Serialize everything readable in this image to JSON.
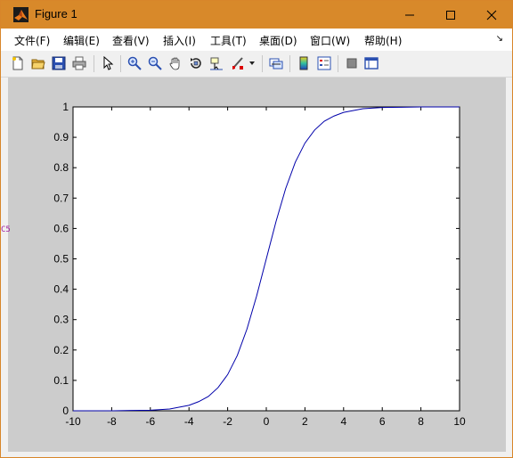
{
  "window": {
    "title": "Figure 1",
    "controls": {
      "minimize": "minimize",
      "maximize": "maximize",
      "close": "close"
    }
  },
  "menu": {
    "items": [
      "文件(F)",
      "编辑(E)",
      "查看(V)",
      "插入(I)",
      "工具(T)",
      "桌面(D)",
      "窗口(W)",
      "帮助(H)"
    ],
    "overflow_arrow": "↘"
  },
  "toolbar": {
    "buttons": [
      "new-figure-icon",
      "open-file-icon",
      "save-icon",
      "print-icon",
      "pointer-icon",
      "zoom-in-icon",
      "zoom-out-icon",
      "pan-hand-icon",
      "rotate-3d-icon",
      "data-cursor-icon",
      "brush-icon",
      "brush-dropdown-icon",
      "link-plot-icon",
      "colorbar-icon",
      "legend-icon",
      "hide-plot-tools-icon",
      "show-plot-tools-icon"
    ]
  },
  "side_mark": "C5",
  "colors": {
    "titlebar": "#d8892a",
    "figure_bg": "#cccccc",
    "line": "#0000aa"
  },
  "chart_data": {
    "type": "line",
    "title": "",
    "xlabel": "",
    "ylabel": "",
    "xlim": [
      -10,
      10
    ],
    "ylim": [
      0,
      1
    ],
    "xticks": [
      -10,
      -8,
      -6,
      -4,
      -2,
      0,
      2,
      4,
      6,
      8,
      10
    ],
    "yticks": [
      0,
      0.1,
      0.2,
      0.3,
      0.4,
      0.5,
      0.6,
      0.7,
      0.8,
      0.9,
      1
    ],
    "ytick_labels": [
      "0",
      "0.1",
      "0.2",
      "0.3",
      "0.4",
      "0.5",
      "0.6",
      "0.7",
      "0.8",
      "0.9",
      "1"
    ],
    "grid": false,
    "series": [
      {
        "color": "#0000aa",
        "x": [
          -10,
          -9,
          -8,
          -7,
          -6,
          -5,
          -4,
          -3.5,
          -3,
          -2.5,
          -2,
          -1.5,
          -1,
          -0.5,
          0,
          0.5,
          1,
          1.5,
          2,
          2.5,
          3,
          3.5,
          4,
          5,
          6,
          7,
          8,
          9,
          10
        ],
        "y": [
          0.0,
          0.0,
          0.0,
          0.001,
          0.002,
          0.006,
          0.018,
          0.03,
          0.047,
          0.076,
          0.119,
          0.182,
          0.269,
          0.378,
          0.5,
          0.622,
          0.731,
          0.818,
          0.881,
          0.924,
          0.953,
          0.97,
          0.982,
          0.994,
          0.998,
          0.999,
          1.0,
          1.0,
          1.0
        ]
      }
    ]
  }
}
